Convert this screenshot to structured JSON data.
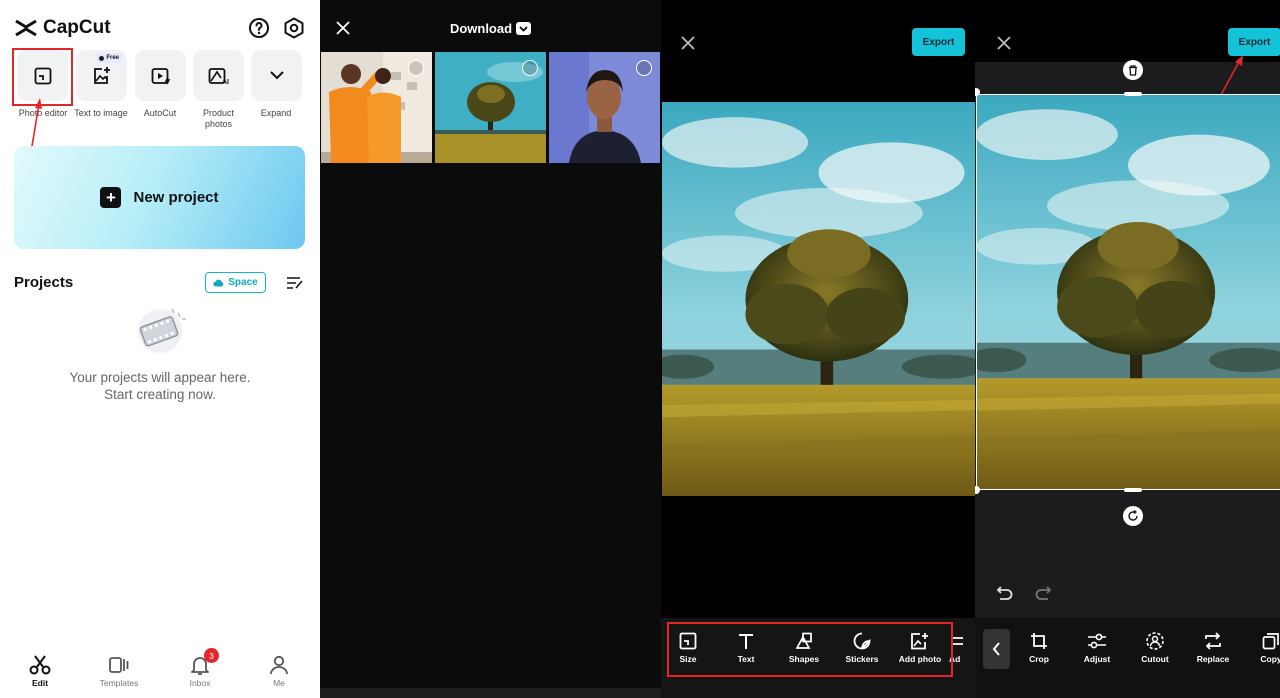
{
  "capcut": {
    "app_name": "CapCut",
    "tools": [
      {
        "label": "Photo editor",
        "icon": "photo-editor-icon"
      },
      {
        "label": "Text to image",
        "icon": "text-to-image-icon",
        "badge": "Free"
      },
      {
        "label": "AutoCut",
        "icon": "autocut-icon"
      },
      {
        "label": "Product photos",
        "icon": "product-photos-icon"
      },
      {
        "label": "Expand",
        "icon": "chevron-down-icon"
      }
    ],
    "new_project_label": "New project",
    "projects_title": "Projects",
    "space_label": "Space",
    "empty_line1": "Your projects will appear here.",
    "empty_line2": "Start creating now.",
    "nav": [
      {
        "label": "Edit",
        "active": true
      },
      {
        "label": "Templates"
      },
      {
        "label": "Inbox",
        "badge": "3"
      },
      {
        "label": "Me"
      }
    ]
  },
  "picker": {
    "title": "Download"
  },
  "editor": {
    "export_label": "Export",
    "tools": [
      {
        "label": "Size",
        "icon": "size-icon"
      },
      {
        "label": "Text",
        "icon": "text-icon"
      },
      {
        "label": "Shapes",
        "icon": "shapes-icon"
      },
      {
        "label": "Stickers",
        "icon": "stickers-icon"
      },
      {
        "label": "Add photo",
        "icon": "add-photo-icon"
      },
      {
        "label": "Ad",
        "icon": "adjust-icon"
      }
    ]
  },
  "crop_editor": {
    "export_label": "Export",
    "tools": [
      {
        "label": "Crop",
        "icon": "crop-icon"
      },
      {
        "label": "Adjust",
        "icon": "adjust-icon"
      },
      {
        "label": "Cutout",
        "icon": "cutout-icon"
      },
      {
        "label": "Replace",
        "icon": "replace-icon"
      },
      {
        "label": "Copy",
        "icon": "copy-icon"
      }
    ]
  },
  "colors": {
    "accent_cyan": "#14c3d8",
    "annotation_red": "#e3262a",
    "dark_bg": "#0b0b0b"
  }
}
